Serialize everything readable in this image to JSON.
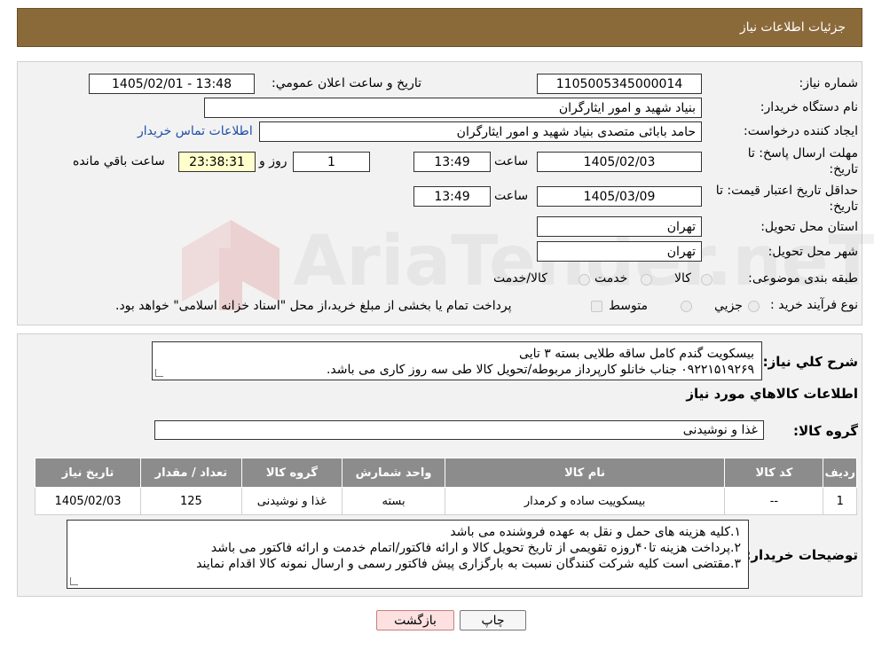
{
  "header": {
    "title": "جزئیات اطلاعات نیاز"
  },
  "form": {
    "need_number_label": "شماره نیاز:",
    "need_number": "1105005345000014",
    "announce_label": "تاریخ و ساعت اعلان عمومي:",
    "announce_value": "1405/02/01 - 13:48",
    "buyer_org_label": "نام دستگاه خريدار:",
    "buyer_org": "بنیاد شهید و امور ایثارگران",
    "creator_label": "ايجاد کننده درخواست:",
    "creator": "حامد بابائی متصدی بنیاد شهید و امور ایثارگران",
    "contact_link": "اطلاعات تماس خريدار",
    "reply_deadline_label_1": "مهلت ارسال پاسخ: تا",
    "reply_deadline_label_2": "تاريخ:",
    "reply_date": "1405/02/03",
    "time_label": "ساعت",
    "reply_time": "13:49",
    "days_value": "1",
    "days_label": "روز و",
    "remaining_time": "23:38:31",
    "remaining_label": "ساعت باقي مانده",
    "price_validity_label_1": "حداقل تاريخ اعتبار قيمت: تا",
    "price_validity_label_2": "تاريخ:",
    "price_date": "1405/03/09",
    "price_time": "13:49",
    "province_label": "استان محل تحويل:",
    "province": "تهران",
    "city_label": "شهر محل تحويل:",
    "city": "تهران",
    "category_label": "طبقه بندی موضوعی:",
    "category_options": [
      "کالا",
      "خدمت",
      "کالا/خدمت"
    ],
    "process_label": "نوع فرآيند خريد :",
    "process_options": [
      "جزيي",
      "متوسط"
    ],
    "process_note": "پرداخت تمام يا بخشی از مبلغ خريد،از محل \"اسناد خزانه اسلامی\" خواهد بود."
  },
  "description": {
    "label": "شرح کلي نياز:",
    "lines": [
      "بیسکویت گندم کامل ساقه طلایی بسته ۳ تایی",
      "۰۹۲۲۱۵۱۹۲۶۹ جناب خانلو کارپرداز مربوطه/تحویل کالا طی سه روز کاری می باشد."
    ]
  },
  "goods_section": {
    "title": "اطلاعات کالاهاي مورد نياز"
  },
  "goods_group": {
    "label": "گروه کالا:",
    "value": "غذا و نوشیدنی"
  },
  "table": {
    "headers": [
      "رديف",
      "کد کالا",
      "نام کالا",
      "واحد شمارش",
      "گروه کالا",
      "تعداد / مقدار",
      "تاريخ نياز"
    ],
    "rows": [
      [
        "1",
        "--",
        "بیسکوییت ساده و کرمدار",
        "بسته",
        "غذا و نوشیدنی",
        "125",
        "1405/02/03"
      ]
    ]
  },
  "buyer_notes": {
    "label": "توضيحات خريدار:",
    "lines": [
      "۱.کلیه هزینه های حمل و نقل به عهده فروشنده می باشد",
      "۲.پرداخت هزینه تا۴۰روزه تقویمی از تاریخ تحویل کالا و ارائه فاکتور/اتمام خدمت و ارائه فاکتور می باشد",
      "۳.مقتضی است کلیه شرکت کنندگان نسبت به بارگزاری پیش فاکتور رسمی و ارسال نمونه کالا اقدام نمایند"
    ]
  },
  "buttons": {
    "print": "چاپ",
    "back": "بازگشت"
  },
  "watermark": {
    "text": "AriaTender.neT"
  },
  "colors": {
    "header": "#8b6a3a",
    "table_header": "#8c8c8c",
    "link": "#1f4ea8"
  }
}
